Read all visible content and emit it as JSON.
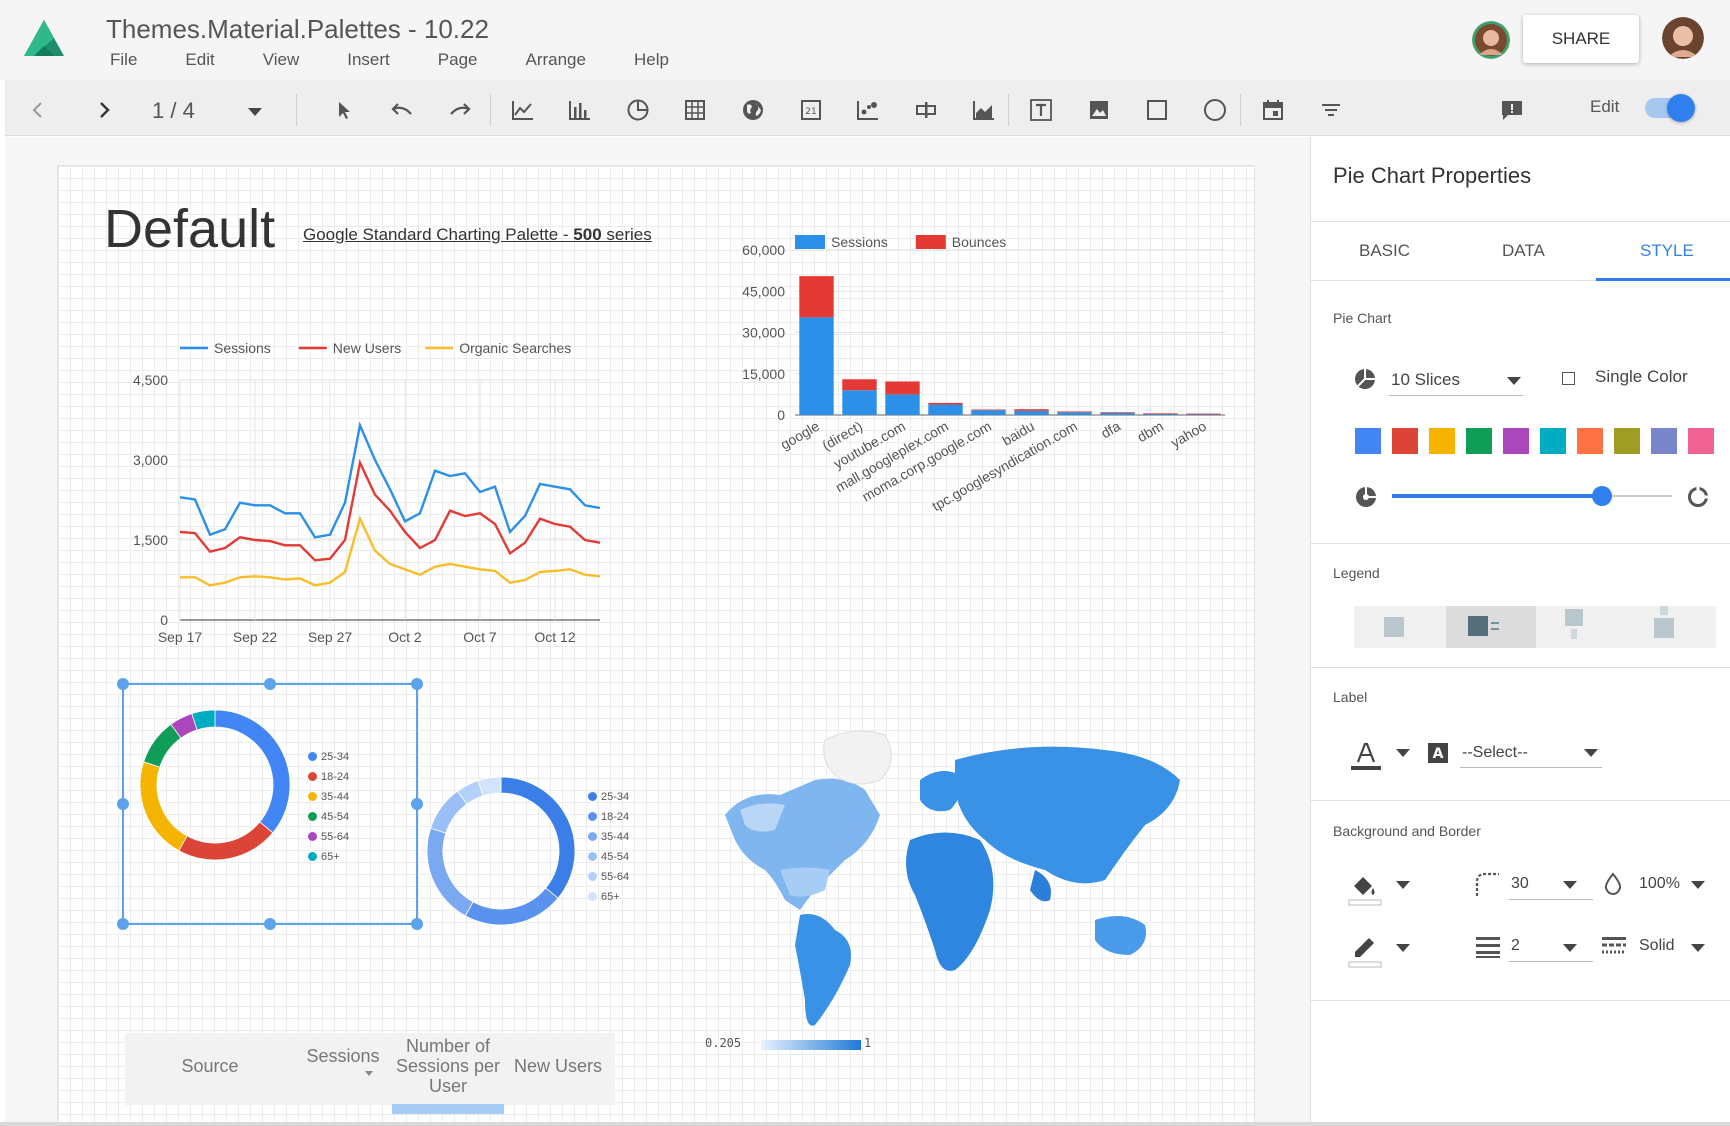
{
  "header": {
    "doc_title": "Themes.Material.Palettes - 10.22",
    "menu": [
      "File",
      "Edit",
      "View",
      "Insert",
      "Page",
      "Arrange",
      "Help"
    ],
    "share_label": "SHARE"
  },
  "toolbar": {
    "page_current": "1",
    "page_total": "4",
    "edit_label": "Edit",
    "edit_toggle_on": true,
    "tool_icons": [
      "pointer-icon",
      "undo-icon",
      "redo-icon",
      "time-series-icon",
      "bar-chart-icon",
      "pie-chart-icon",
      "table-icon",
      "geo-map-icon",
      "scorecard-icon",
      "scatter-icon",
      "bullet-icon",
      "area-chart-icon",
      "text-icon",
      "image-icon",
      "rectangle-icon",
      "circle-icon",
      "date-range-icon",
      "filter-icon"
    ]
  },
  "canvas": {
    "title": "Default",
    "palette_link": "Google Standard Charting Palette - ",
    "palette_link_bold": "500",
    "palette_link_suffix": " series"
  },
  "chart_data": [
    {
      "type": "line",
      "title": "",
      "x_ticks": [
        "Sep 17",
        "Sep 22",
        "Sep 27",
        "Oct 2",
        "Oct 7",
        "Oct 12"
      ],
      "y_ticks": [
        "0",
        "1,500",
        "3,000",
        "4,500"
      ],
      "ylim": [
        0,
        4500
      ],
      "legend_position": "top",
      "grid": true,
      "series": [
        {
          "name": "Sessions",
          "color": "#2b90e8",
          "values": [
            2300,
            2260,
            1600,
            1700,
            2200,
            2150,
            2150,
            2000,
            2000,
            1550,
            1600,
            2200,
            3650,
            3000,
            2450,
            1850,
            2000,
            2800,
            2700,
            2750,
            2400,
            2500,
            1650,
            1950,
            2550,
            2500,
            2450,
            2150,
            2100
          ]
        },
        {
          "name": "New Users",
          "color": "#e53935",
          "values": [
            1650,
            1630,
            1280,
            1350,
            1550,
            1500,
            1480,
            1400,
            1400,
            1120,
            1150,
            1500,
            2950,
            2350,
            2050,
            1650,
            1350,
            1500,
            2050,
            1950,
            2000,
            1800,
            1250,
            1450,
            1900,
            1800,
            1750,
            1500,
            1450
          ]
        },
        {
          "name": "Organic Searches",
          "color": "#f9bd29",
          "values": [
            800,
            800,
            650,
            700,
            800,
            820,
            800,
            760,
            780,
            650,
            700,
            900,
            1900,
            1300,
            1050,
            950,
            850,
            1000,
            1050,
            1000,
            950,
            920,
            700,
            750,
            900,
            920,
            950,
            850,
            820
          ]
        }
      ]
    },
    {
      "type": "bar",
      "stacked": true,
      "title": "",
      "categories": [
        "google",
        "(direct)",
        "youtube.com",
        "mall.googleplex.com",
        "moma.corp.google.com",
        "baidu",
        "tpc.googlesyndication.com",
        "dfa",
        "dbm",
        "yahoo"
      ],
      "y_ticks": [
        "0",
        "15,000",
        "30,000",
        "45,000",
        "60,000"
      ],
      "ylim": [
        0,
        60000
      ],
      "legend_position": "top",
      "series": [
        {
          "name": "Sessions",
          "color": "#2b90e8",
          "values": [
            35500,
            9000,
            7500,
            3800,
            1700,
            1500,
            1000,
            800,
            500,
            400
          ]
        },
        {
          "name": "Bounces",
          "color": "#e53935",
          "values": [
            15000,
            4000,
            4700,
            600,
            300,
            600,
            300,
            200,
            100,
            100
          ]
        }
      ]
    },
    {
      "type": "pie",
      "donut": true,
      "legend_position": "right",
      "labels": [
        "25-34",
        "18-24",
        "35-44",
        "45-54",
        "55-64",
        "65+"
      ],
      "colors": [
        "#4285f4",
        "#db4437",
        "#f4b400",
        "#0f9d58",
        "#ab47bc",
        "#00acc1"
      ],
      "values": [
        36,
        22,
        22,
        10,
        5,
        5
      ]
    },
    {
      "type": "pie",
      "donut": true,
      "legend_position": "right",
      "labels": [
        "25-34",
        "18-24",
        "35-44",
        "45-54",
        "55-64",
        "65+"
      ],
      "colors": [
        "#3b7ee8",
        "#5a93ee",
        "#7aa9f2",
        "#9abff6",
        "#b6d1f8",
        "#d2e3fb"
      ],
      "values": [
        36,
        22,
        22,
        10,
        5,
        5
      ]
    },
    {
      "type": "geo",
      "scale_min_label": "0.205",
      "scale_max_label": "1"
    }
  ],
  "table": {
    "headers": [
      "Source",
      "Sessions",
      "Number of Sessions per User",
      "New Users"
    ]
  },
  "panel": {
    "title": "Pie Chart Properties",
    "tabs": [
      "BASIC",
      "DATA",
      "STYLE"
    ],
    "active_tab": "STYLE",
    "pie_section": "Pie Chart",
    "slices_value": "10 Slices",
    "single_color_label": "Single Color",
    "slice_colors": [
      "#4285f4",
      "#db4437",
      "#f4b400",
      "#0f9d58",
      "#ab47bc",
      "#00acc1",
      "#ff7043",
      "#9e9d24",
      "#7986cb",
      "#f06292"
    ],
    "donut_level": 0.75,
    "legend_section": "Legend",
    "label_section": "Label",
    "label_select": "--Select--",
    "bg_section": "Background and Border",
    "radius_value": "30",
    "opacity_value": "100%",
    "border_weight": "2",
    "border_style": "Solid"
  }
}
